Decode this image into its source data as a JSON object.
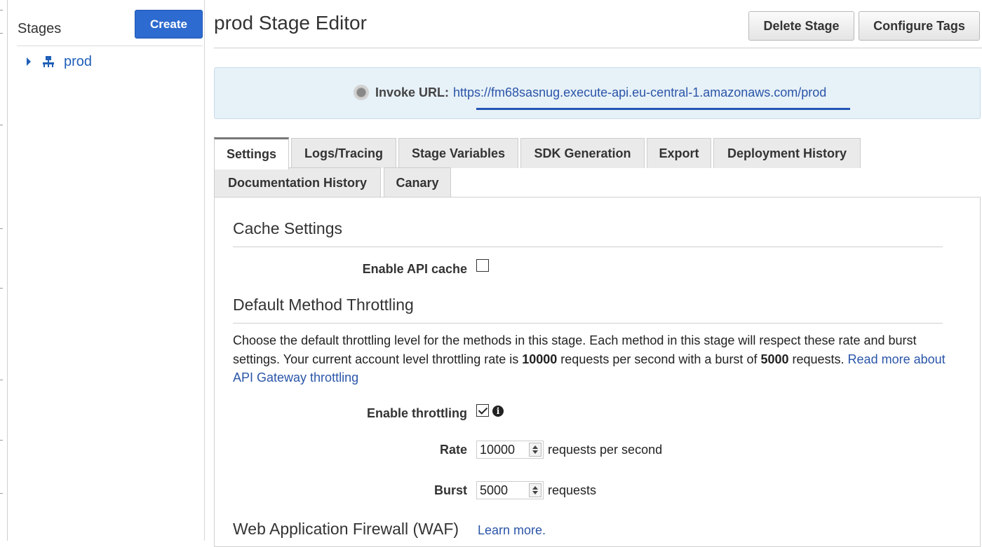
{
  "sidebar": {
    "title": "Stages",
    "create_label": "Create",
    "stages": [
      {
        "label": "prod",
        "icon": "stage-icon"
      }
    ]
  },
  "header": {
    "title": "prod Stage Editor",
    "delete_label": "Delete Stage",
    "tags_label": "Configure Tags"
  },
  "invoke": {
    "label": "Invoke URL:",
    "url": "https://fm68sasnug.execute-api.eu-central-1.amazonaws.com/prod"
  },
  "tabs": [
    {
      "label": "Settings",
      "active": true
    },
    {
      "label": "Logs/Tracing"
    },
    {
      "label": "Stage Variables"
    },
    {
      "label": "SDK Generation"
    },
    {
      "label": "Export"
    },
    {
      "label": "Deployment History"
    },
    {
      "label": "Documentation History"
    },
    {
      "label": "Canary"
    }
  ],
  "cache": {
    "title": "Cache Settings",
    "enable_label": "Enable API cache",
    "enabled": false
  },
  "throttling": {
    "title": "Default Method Throttling",
    "desc_part1": "Choose the default throttling level for the methods in this stage. Each method in this stage will respect these rate and burst settings. Your current account level throttling rate is ",
    "account_rate": "10000",
    "desc_part2": " requests per second with a burst of ",
    "account_burst": "5000",
    "desc_part3": " requests. ",
    "read_more": "Read more about API Gateway throttling",
    "enable_label": "Enable throttling",
    "enabled": true,
    "rate_label": "Rate",
    "rate_value": "10000",
    "rate_suffix": "requests per second",
    "burst_label": "Burst",
    "burst_value": "5000",
    "burst_suffix": "requests"
  },
  "waf": {
    "title": "Web Application Firewall (WAF)",
    "learn_more": "Learn more."
  },
  "colors": {
    "accent": "#2e6bd0",
    "link": "#2a55a8",
    "invoke_bg": "#e7f1f8"
  }
}
